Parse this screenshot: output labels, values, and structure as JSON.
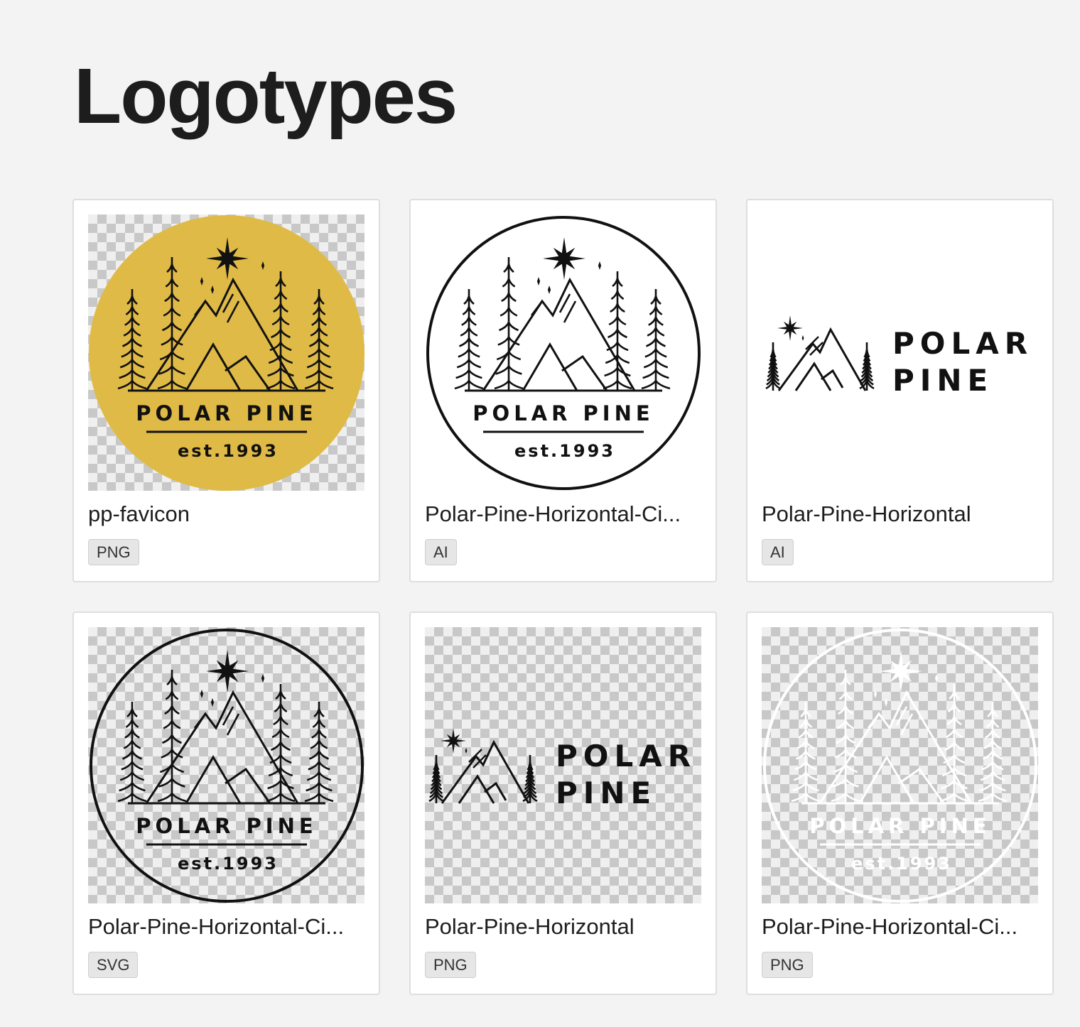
{
  "page": {
    "title": "Logotypes"
  },
  "logo_text": {
    "name_line": "POLAR PINE",
    "word1": "POLAR",
    "word2": "PINE",
    "est": "est.1993"
  },
  "colors": {
    "gold": "#e0ba46",
    "dark": "#111111",
    "white": "#ffffff"
  },
  "assets": [
    {
      "name": "pp-favicon",
      "type": "PNG",
      "variant": "circle-gold",
      "background": "transparent"
    },
    {
      "name": "Polar-Pine-Horizontal-Ci...",
      "type": "AI",
      "variant": "circle-black",
      "background": "white"
    },
    {
      "name": "Polar-Pine-Horizontal",
      "type": "AI",
      "variant": "horizontal-black",
      "background": "white"
    },
    {
      "name": "Polar-Pine-Horizontal-Ci...",
      "type": "SVG",
      "variant": "circle-black",
      "background": "transparent"
    },
    {
      "name": "Polar-Pine-Horizontal",
      "type": "PNG",
      "variant": "horizontal-black",
      "background": "transparent"
    },
    {
      "name": "Polar-Pine-Horizontal-Ci...",
      "type": "PNG",
      "variant": "circle-white",
      "background": "transparent"
    }
  ]
}
